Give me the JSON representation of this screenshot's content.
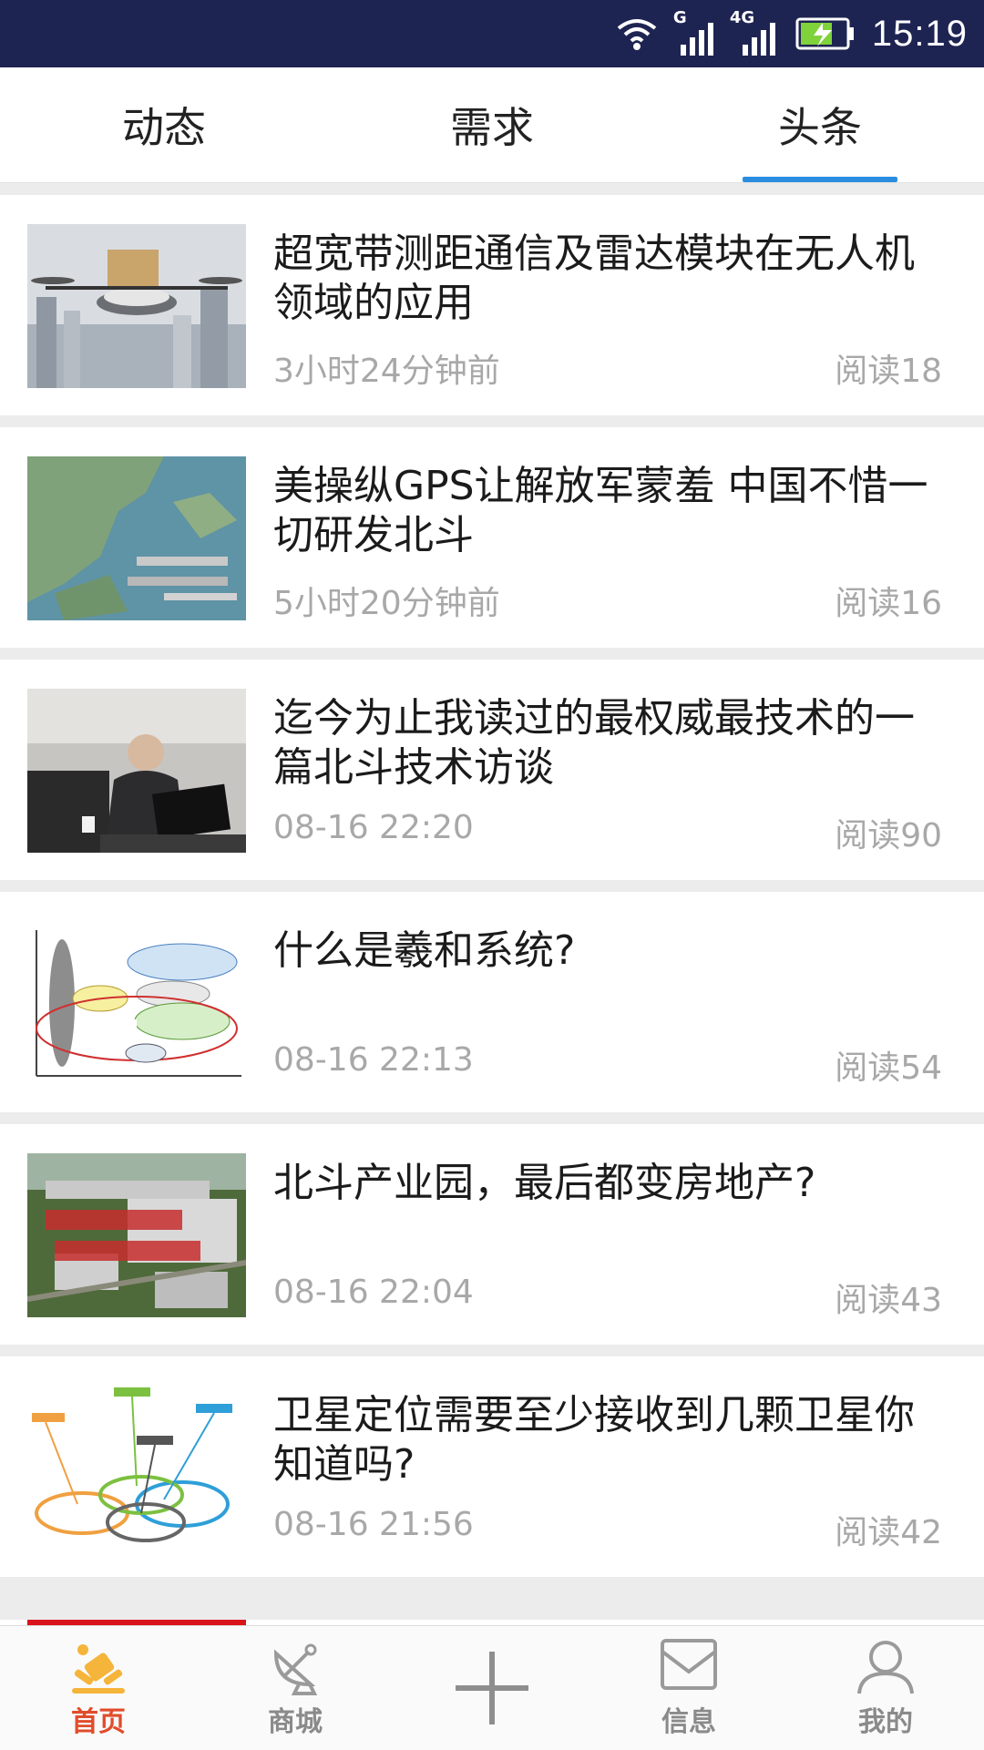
{
  "status_bar": {
    "signal_1_label": "G",
    "signal_2_label": "4G",
    "time": "15:19",
    "icons": [
      "wifi-icon",
      "signal-icon",
      "signal-4g-icon",
      "battery-charging-icon"
    ]
  },
  "tabs": [
    {
      "label": "动态",
      "active": false
    },
    {
      "label": "需求",
      "active": false
    },
    {
      "label": "头条",
      "active": true
    }
  ],
  "colors": {
    "status_bar": "#1e2452",
    "tab_indicator": "#2b8de0",
    "nav_active": "#e04d2c",
    "meta_text": "#a8a8a8"
  },
  "articles": [
    {
      "title": "超宽带测距通信及雷达模块在无人机领域的应用",
      "time": "3小时24分钟前",
      "reads": "阅读18",
      "thumb": "drone-delivery-image"
    },
    {
      "title": "美操纵GPS让解放军蒙羞 中国不惜一切研发北斗",
      "time": "5小时20分钟前",
      "reads": "阅读16",
      "thumb": "map-warships-image"
    },
    {
      "title": "迄今为止我读过的最权威最技术的一篇北斗技术访谈",
      "time": "08-16 22:20",
      "reads": "阅读90",
      "thumb": "speaker-laptop-image"
    },
    {
      "title": "什么是羲和系统?",
      "time": "08-16 22:13",
      "reads": "阅读54",
      "thumb": "xihe-diagram-image"
    },
    {
      "title": "北斗产业园，最后都变房地产?",
      "time": "08-16 22:04",
      "reads": "阅读43",
      "thumb": "industrial-park-image"
    },
    {
      "title": "卫星定位需要至少接收到几颗卫星你知道吗?",
      "time": "08-16 21:56",
      "reads": "阅读42",
      "thumb": "satellite-rings-image"
    }
  ],
  "bottom_nav": [
    {
      "label": "首页",
      "icon": "home-icon",
      "active": true
    },
    {
      "label": "商城",
      "icon": "satellite-dish-icon",
      "active": false
    },
    {
      "label": "",
      "icon": "plus-icon",
      "active": false
    },
    {
      "label": "信息",
      "icon": "mail-icon",
      "active": false
    },
    {
      "label": "我的",
      "icon": "user-icon",
      "active": false
    }
  ]
}
